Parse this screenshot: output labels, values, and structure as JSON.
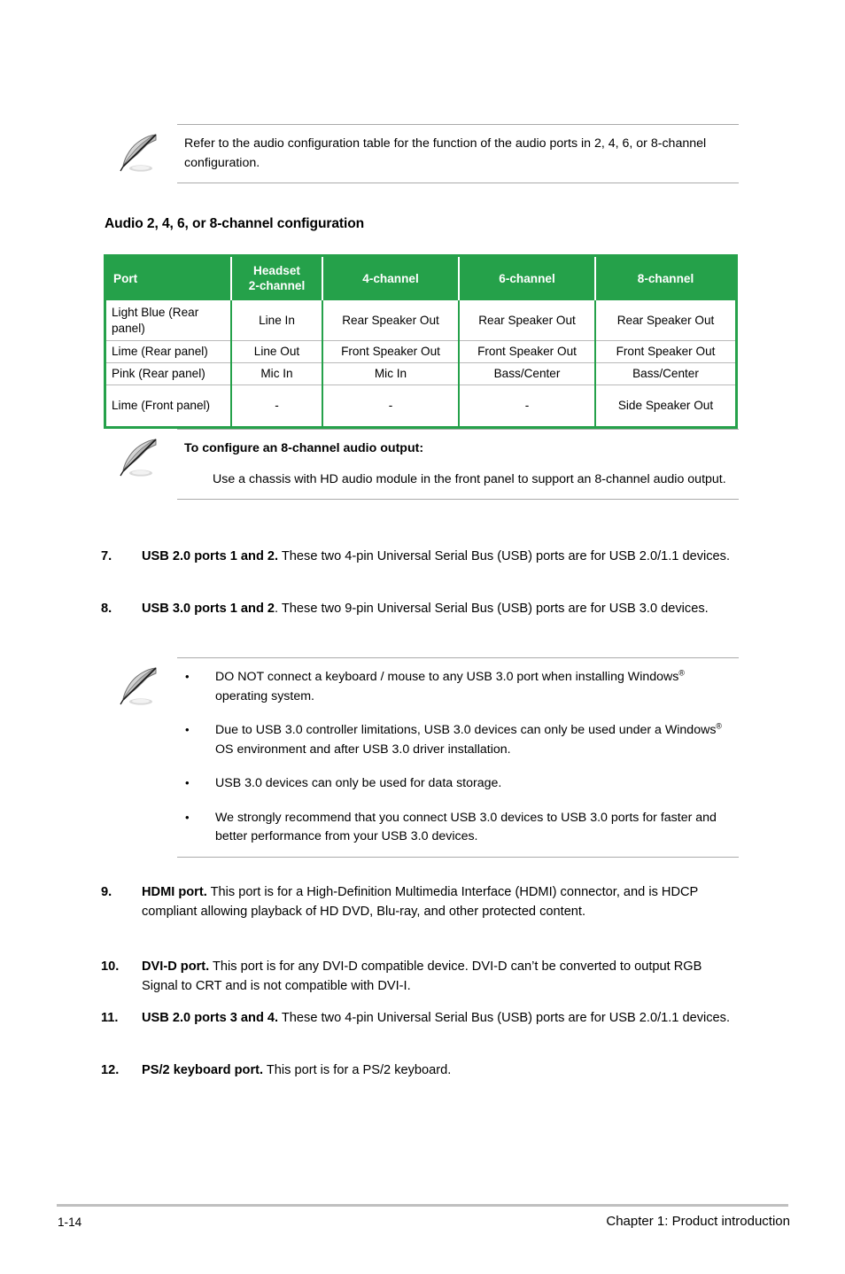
{
  "page": {
    "footer_page_number": "1-14",
    "footer_chapter": "Chapter 1: Product introduction"
  },
  "note_audio": {
    "icon": "quill-pen-icon",
    "text": "Refer to the audio configuration table for the function of the audio ports in 2, 4, 6, or 8-channel configuration."
  },
  "audio_section": {
    "heading": "Audio 2, 4, 6, or 8-channel configuration",
    "accent_color": "#25a14a",
    "table": {
      "headers": [
        "Port",
        "Headset\n2-channel",
        "4-channel",
        "6-channel",
        "8-channel"
      ],
      "header_port": "Port",
      "header_headset_line1": "Headset",
      "header_headset_line2": "2-channel",
      "header_4ch": "4-channel",
      "header_6ch": "6-channel",
      "header_8ch": "8-channel",
      "rows": [
        {
          "port": "Light Blue (Rear panel)",
          "ch2": "Line In",
          "ch4": "Rear Speaker Out",
          "ch6": "Rear Speaker Out",
          "ch8": "Rear Speaker Out"
        },
        {
          "port": "Lime (Rear panel)",
          "ch2": "Line Out",
          "ch4": "Front Speaker Out",
          "ch6": "Front Speaker Out",
          "ch8": "Front Speaker Out"
        },
        {
          "port": "Pink (Rear panel)",
          "ch2": "Mic In",
          "ch4": "Mic In",
          "ch6": "Bass/Center",
          "ch8": "Bass/Center"
        },
        {
          "port": "Lime (Front panel)",
          "ch2": "-",
          "ch4": "-",
          "ch6": "-",
          "ch8": "Side Speaker Out"
        }
      ]
    }
  },
  "note_8channel": {
    "icon": "quill-pen-icon",
    "title": "To configure an 8-channel audio output:",
    "body": "Use a chassis with HD audio module in the front panel to support an 8-channel audio output."
  },
  "items": {
    "item7": {
      "number": "7.",
      "bold": "USB 2.0 ports 1 and 2.",
      "rest": " These two 4-pin Universal Serial Bus (USB) ports are for USB 2.0/1.1 devices."
    },
    "item8": {
      "number": "8.",
      "bold": "USB 3.0 ports 1 and 2",
      "rest": ". These two 9-pin Universal Serial Bus (USB) ports are for USB 3.0 devices."
    },
    "item9": {
      "number": "9.",
      "bold": "HDMI port.",
      "rest": " This port is for a High-Definition Multimedia Interface (HDMI) connector, and is HDCP compliant allowing playback of HD DVD, Blu-ray, and other protected content."
    },
    "item10": {
      "number": "10.",
      "bold": "DVI-D port.",
      "rest": " This port is for any DVI-D compatible device.  DVI-D can’t be converted to output RGB Signal to CRT and is not compatible with DVI-I."
    },
    "item11": {
      "number": "11.",
      "bold": "USB 2.0 ports 3 and 4.",
      "rest": " These two 4-pin Universal Serial Bus (USB) ports are for USB 2.0/1.1 devices."
    },
    "item12": {
      "number": "12.",
      "bold": "PS/2 keyboard port.",
      "rest": " This port is for a PS/2 keyboard."
    }
  },
  "note_usb3": {
    "icon": "quill-pen-icon",
    "bullet_char": "•",
    "bullets": [
      {
        "pre": "DO NOT connect a keyboard / mouse to any USB 3.0 port when installing Windows",
        "sup": "®",
        "post": " operating system."
      },
      {
        "pre": "Due to USB 3.0 controller limitations, USB 3.0 devices can only be used under a Windows",
        "sup": "®",
        "post": " OS environment and after USB 3.0 driver installation."
      },
      {
        "pre": "USB 3.0 devices can only be used for data storage.",
        "sup": "",
        "post": ""
      },
      {
        "pre": "We strongly recommend that you connect USB 3.0 devices to USB 3.0 ports for faster and better performance from your USB 3.0 devices.",
        "sup": "",
        "post": ""
      }
    ]
  }
}
